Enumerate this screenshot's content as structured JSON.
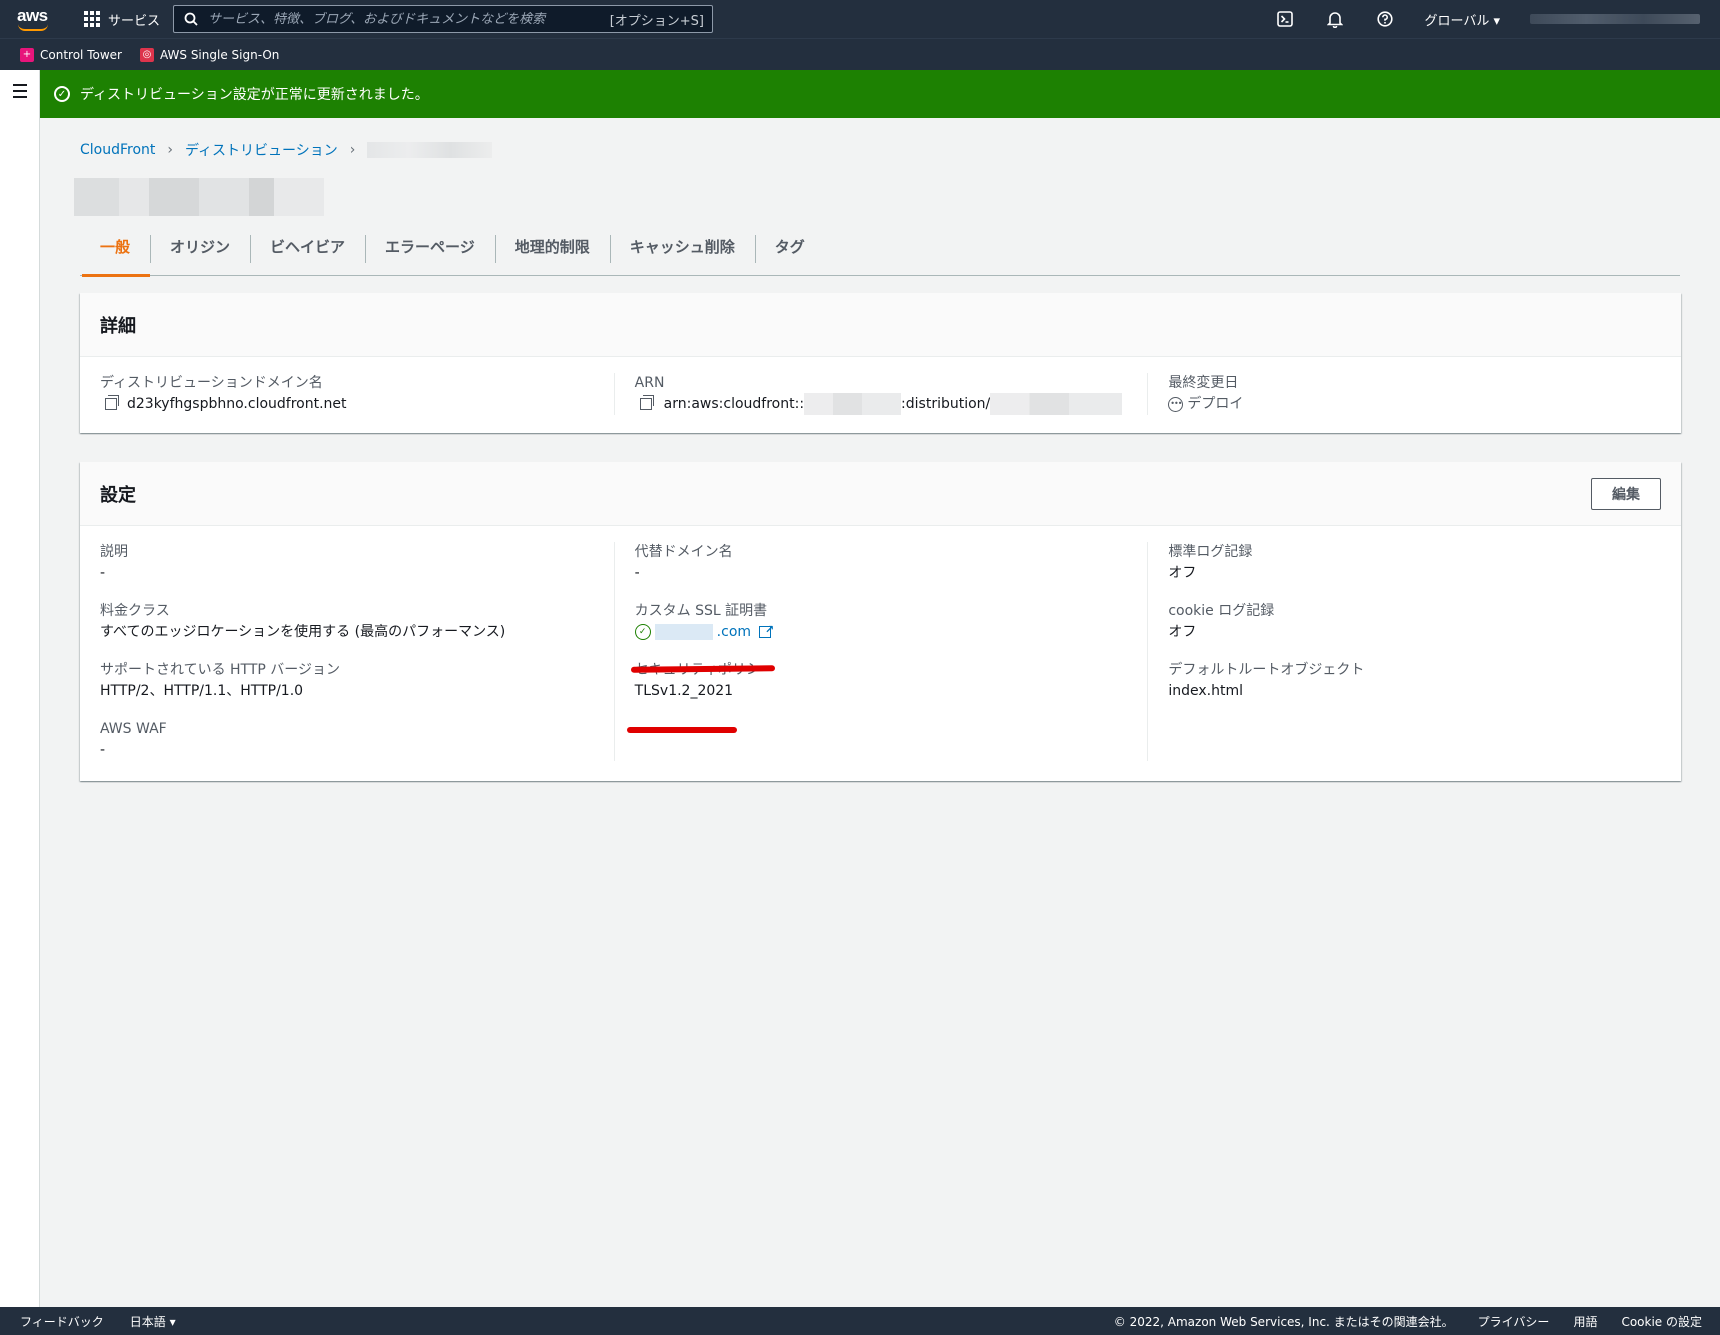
{
  "topnav": {
    "logo": "aws",
    "services_label": "サービス",
    "search_placeholder": "サービス、特徴、ブログ、およびドキュメントなどを検索",
    "search_shortcut": "[オプション+S]",
    "region_label": "グローバル ▾",
    "icons": [
      "cloudshell-icon",
      "bell-icon",
      "help-icon"
    ]
  },
  "favorites": [
    {
      "label": "Control Tower",
      "color": "#e7157b"
    },
    {
      "label": "AWS Single Sign-On",
      "color": "#dd344c"
    }
  ],
  "flash": {
    "message": "ディストリビューション設定が正常に更新されました。",
    "color": "#1d8102"
  },
  "breadcrumb": {
    "root": "CloudFront",
    "second": "ディストリビューション"
  },
  "tabs": [
    "一般",
    "オリジン",
    "ビヘイビア",
    "エラーページ",
    "地理的制限",
    "キャッシュ削除",
    "タグ"
  ],
  "details": {
    "title": "詳細",
    "domain_label": "ディストリビューションドメイン名",
    "domain_value": "d23kyfhgspbhno.cloudfront.net",
    "arn_label": "ARN",
    "arn_prefix": "arn:aws:cloudfront::",
    "arn_mid": ":distribution/",
    "modified_label": "最終変更日",
    "modified_value": "デプロイ"
  },
  "settings": {
    "title": "設定",
    "edit_label": "編集",
    "description_label": "説明",
    "description_value": "-",
    "price_class_label": "料金クラス",
    "price_class_value": "すべてのエッジロケーションを使用する (最高のパフォーマンス)",
    "http_label": "サポートされている HTTP バージョン",
    "http_value": "HTTP/2、HTTP/1.1、HTTP/1.0",
    "waf_label": "AWS WAF",
    "waf_value": "-",
    "alt_domain_label": "代替ドメイン名",
    "alt_domain_value": "-",
    "ssl_label": "カスタム SSL 証明書",
    "ssl_value_suffix": ".com",
    "policy_label": "セキュリティポリシー",
    "policy_value": "TLSv1.2_2021",
    "std_log_label": "標準ログ記録",
    "std_log_value": "オフ",
    "cookie_log_label": "cookie ログ記録",
    "cookie_log_value": "オフ",
    "root_object_label": "デフォルトルートオブジェクト",
    "root_object_value": "index.html"
  },
  "footer": {
    "feedback": "フィードバック",
    "language": "日本語 ▾",
    "copyright": "© 2022, Amazon Web Services, Inc. またはその関連会社。",
    "privacy": "プライバシー",
    "terms": "用語",
    "cookie": "Cookie の設定"
  }
}
